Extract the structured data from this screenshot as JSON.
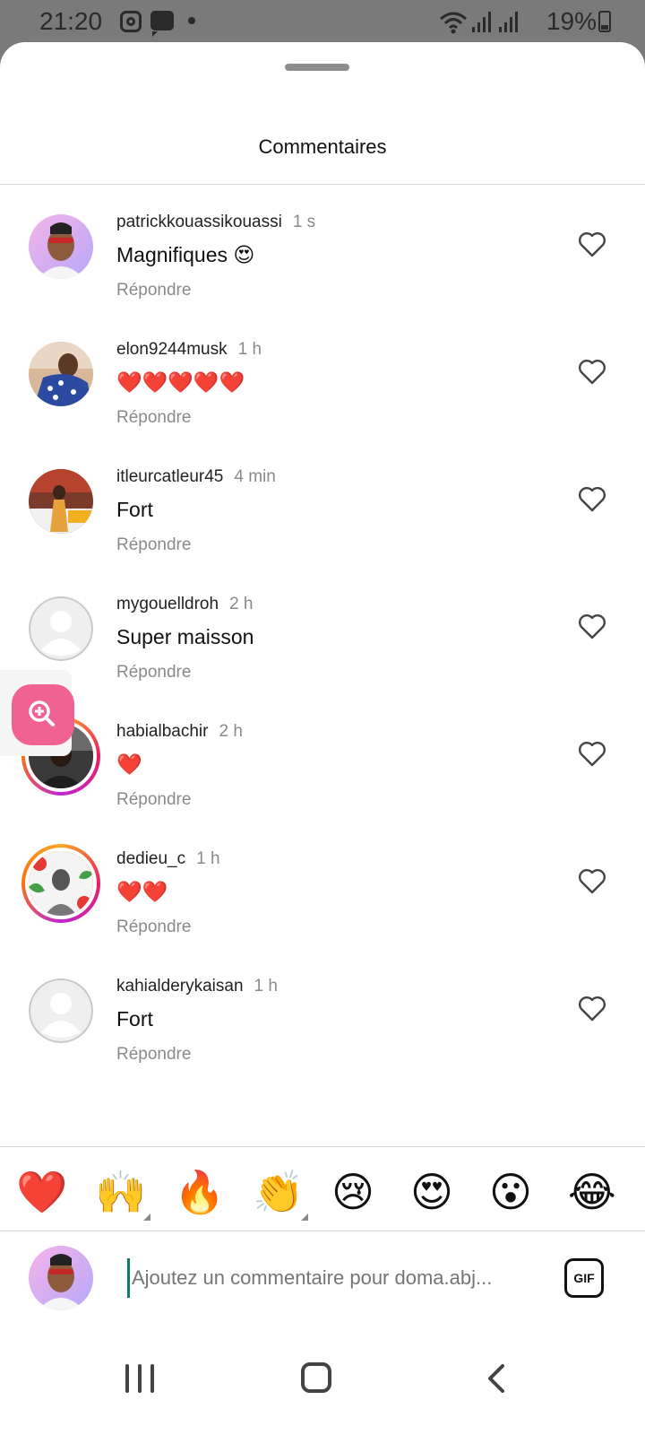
{
  "status_bar": {
    "time": "21:20",
    "battery": "19%",
    "icons": [
      "instagram-icon",
      "message-icon",
      "dot-icon",
      "wifi-icon",
      "signal-icon",
      "signal-icon",
      "battery-icon"
    ]
  },
  "sheet": {
    "title": "Commentaires"
  },
  "comments": [
    {
      "username": "patrickkouassikouassi",
      "time": "1 s",
      "text": "Magnifiques 😍",
      "reply": "Répondre",
      "avatar": "avatar-cartoon-pink",
      "ring": false
    },
    {
      "username": "elon9244musk",
      "time": "1 h",
      "text": "❤️❤️❤️❤️❤️",
      "reply": "Répondre",
      "avatar": "avatar-photo-man",
      "ring": false
    },
    {
      "username": "itleurcatleur45",
      "time": "4 min",
      "text": "Fort",
      "reply": "Répondre",
      "avatar": "avatar-photo-stage",
      "ring": false
    },
    {
      "username": "mygouelldroh",
      "time": "2 h",
      "text": "Super maisson",
      "reply": "Répondre",
      "avatar": "avatar-default",
      "ring": false
    },
    {
      "username": "habialbachir",
      "time": "2 h",
      "text": "❤️",
      "reply": "Répondre",
      "avatar": "avatar-photo-dark",
      "ring": true
    },
    {
      "username": "dedieu_c",
      "time": "1 h",
      "text": "❤️❤️",
      "reply": "Répondre",
      "avatar": "avatar-photo-flowers",
      "ring": true
    },
    {
      "username": "kahialderykaisan",
      "time": "1 h",
      "text": "Fort",
      "reply": "Répondre",
      "avatar": "avatar-default",
      "ring": false
    }
  ],
  "reactions": [
    "❤️",
    "🙌",
    "🔥",
    "👏",
    "😢",
    "😍",
    "😮",
    "😂"
  ],
  "composer": {
    "placeholder": "Ajoutez un commentaire pour doma.abj...",
    "gif_label": "GIF"
  },
  "colors": {
    "accent_pink": "#f06292",
    "story_ring": "#e91e63",
    "muted": "#8a8a8a"
  }
}
